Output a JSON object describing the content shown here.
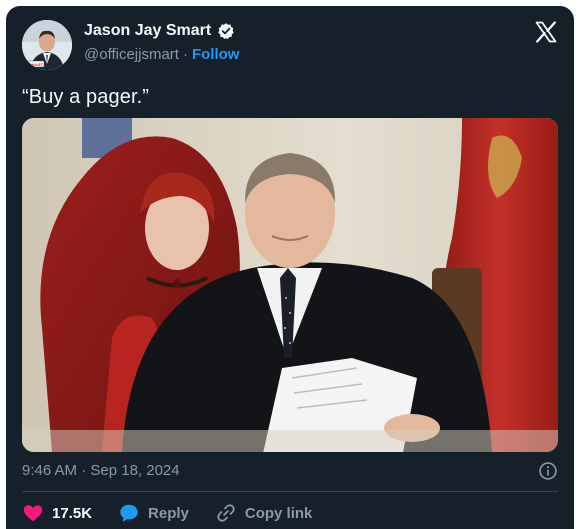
{
  "author": {
    "display_name": "Jason Jay Smart",
    "handle": "@officejjsmart",
    "separator": "·",
    "follow_label": "Follow",
    "avatar_badge_text": "SMART",
    "verified_icon": "verified-badge-icon"
  },
  "tweet": {
    "text": "“Buy a pager.”",
    "timestamp": "9:46 AM · Sep 18, 2024"
  },
  "actions": {
    "likes_count": "17.5K",
    "reply_label": "Reply",
    "copy_link_label": "Copy link"
  },
  "icons": {
    "x_logo": "x-logo-icon",
    "info": "info-icon",
    "like": "heart-icon",
    "reply": "speech-bubble-icon",
    "copy_link": "link-icon"
  },
  "colors": {
    "background": "#15202b",
    "text_primary": "#f7f9f9",
    "text_secondary": "#8b98a5",
    "accent": "#1d9bf0",
    "like": "#f91880",
    "divider": "#38444d"
  }
}
